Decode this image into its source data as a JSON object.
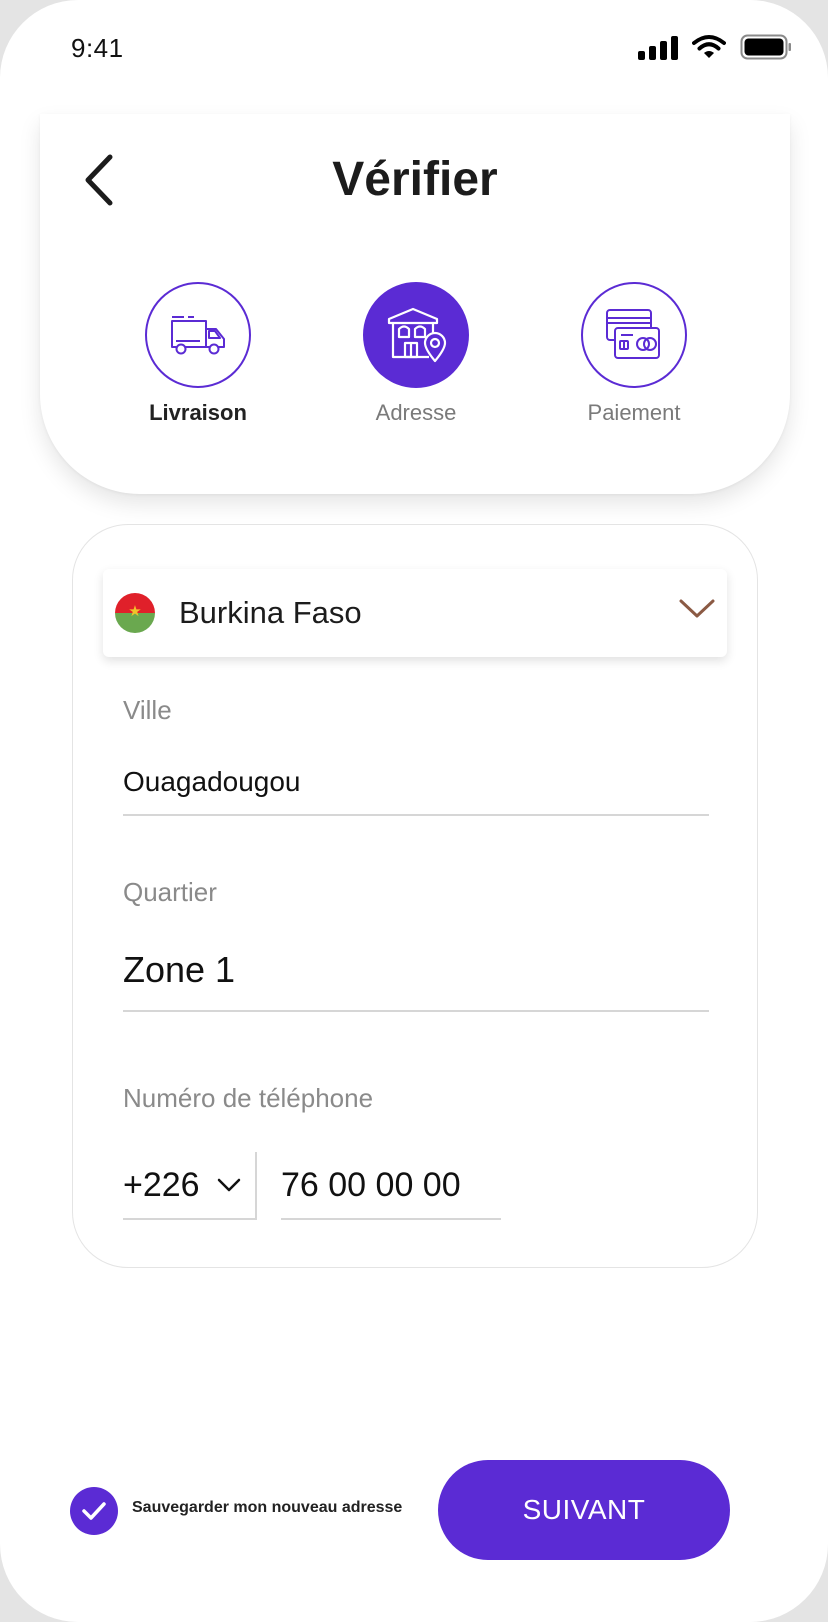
{
  "status_bar": {
    "time": "9:41"
  },
  "header": {
    "title": "Vérifier",
    "steps": [
      {
        "label": "Livraison",
        "icon": "truck-icon",
        "state": "completed"
      },
      {
        "label": "Adresse",
        "icon": "house-location-icon",
        "state": "active"
      },
      {
        "label": "Paiement",
        "icon": "credit-card-icon",
        "state": "upcoming"
      }
    ]
  },
  "form": {
    "country": {
      "value": "Burkina Faso",
      "flag": "burkina-faso-flag"
    },
    "city": {
      "label": "Ville",
      "value": "Ouagadougou"
    },
    "district": {
      "label": "Quartier",
      "value": "Zone 1"
    },
    "phone": {
      "label": "Numéro de téléphone",
      "code": "+226",
      "number": "76 00 00 00"
    }
  },
  "footer": {
    "save_label": "Sauvegarder mon nouveau adresse",
    "save_checked": true,
    "next_label": "SUIVANT"
  },
  "colors": {
    "accent": "#5b2bd4",
    "chevron": "#8b5a44"
  }
}
